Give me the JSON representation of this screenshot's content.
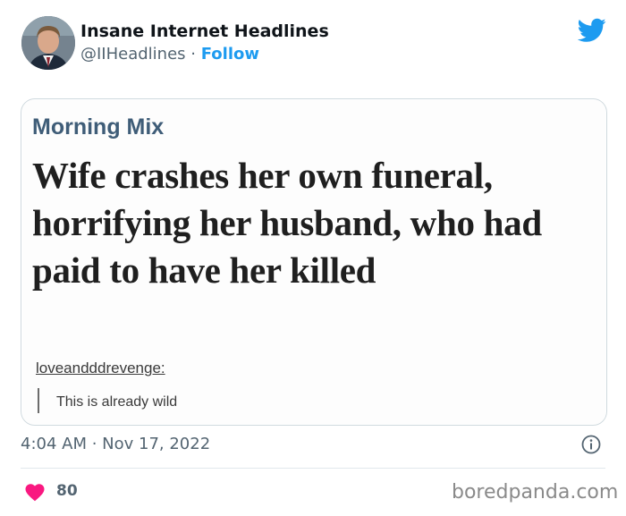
{
  "tweet": {
    "author_name": "Insane Internet Headlines",
    "handle": "@IIHeadlines",
    "separator": " · ",
    "follow_label": "Follow",
    "timestamp": "4:04 AM · Nov 17, 2022",
    "like_count": "80"
  },
  "embedded_image": {
    "section_title": "Morning Mix",
    "headline": "Wife crashes her own funeral, horrifying her husband, who had paid to have her killed",
    "tumblr_user": "loveandddrevenge:",
    "quote": "This is already wild"
  },
  "watermark": "boredpanda.com",
  "icons": [
    "twitter-bird-icon",
    "info-icon",
    "heart-icon"
  ],
  "colors": {
    "accent": "#1d9bf0",
    "like": "#f91880",
    "secondary_text": "#536471",
    "section_title": "#3f5d78"
  }
}
